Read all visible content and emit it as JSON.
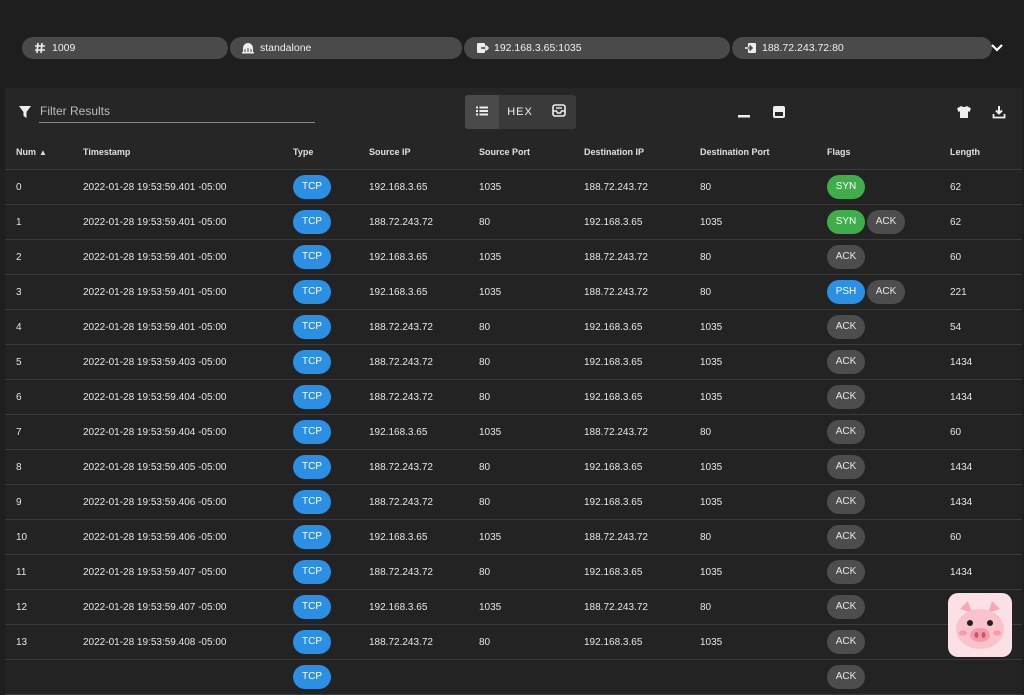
{
  "header": {
    "chips": [
      {
        "icon": "hash-icon",
        "label": "1009"
      },
      {
        "icon": "network-icon",
        "label": "standalone"
      },
      {
        "icon": "login-icon",
        "label": "192.168.3.65:1035"
      },
      {
        "icon": "logout-icon",
        "label": "188.72.243.72:80"
      }
    ]
  },
  "toolbar": {
    "filter_placeholder": "Filter Results",
    "hex_label": "HEX"
  },
  "table": {
    "columns": {
      "num": "Num",
      "timestamp": "Timestamp",
      "type": "Type",
      "src_ip": "Source IP",
      "src_port": "Source Port",
      "dst_ip": "Destination IP",
      "dst_port": "Destination Port",
      "flags": "Flags",
      "length": "Length"
    },
    "rows": [
      {
        "num": "0",
        "ts": "2022-01-28 19:53:59.401 -05:00",
        "type": "TCP",
        "src_ip": "192.168.3.65",
        "src_port": "1035",
        "dst_ip": "188.72.243.72",
        "dst_port": "80",
        "flags": [
          "SYN"
        ],
        "length": "62"
      },
      {
        "num": "1",
        "ts": "2022-01-28 19:53:59.401 -05:00",
        "type": "TCP",
        "src_ip": "188.72.243.72",
        "src_port": "80",
        "dst_ip": "192.168.3.65",
        "dst_port": "1035",
        "flags": [
          "SYN",
          "ACK"
        ],
        "length": "62"
      },
      {
        "num": "2",
        "ts": "2022-01-28 19:53:59.401 -05:00",
        "type": "TCP",
        "src_ip": "192.168.3.65",
        "src_port": "1035",
        "dst_ip": "188.72.243.72",
        "dst_port": "80",
        "flags": [
          "ACK"
        ],
        "length": "60"
      },
      {
        "num": "3",
        "ts": "2022-01-28 19:53:59.401 -05:00",
        "type": "TCP",
        "src_ip": "192.168.3.65",
        "src_port": "1035",
        "dst_ip": "188.72.243.72",
        "dst_port": "80",
        "flags": [
          "PSH",
          "ACK"
        ],
        "length": "221"
      },
      {
        "num": "4",
        "ts": "2022-01-28 19:53:59.401 -05:00",
        "type": "TCP",
        "src_ip": "188.72.243.72",
        "src_port": "80",
        "dst_ip": "192.168.3.65",
        "dst_port": "1035",
        "flags": [
          "ACK"
        ],
        "length": "54"
      },
      {
        "num": "5",
        "ts": "2022-01-28 19:53:59.403 -05:00",
        "type": "TCP",
        "src_ip": "188.72.243.72",
        "src_port": "80",
        "dst_ip": "192.168.3.65",
        "dst_port": "1035",
        "flags": [
          "ACK"
        ],
        "length": "1434"
      },
      {
        "num": "6",
        "ts": "2022-01-28 19:53:59.404 -05:00",
        "type": "TCP",
        "src_ip": "188.72.243.72",
        "src_port": "80",
        "dst_ip": "192.168.3.65",
        "dst_port": "1035",
        "flags": [
          "ACK"
        ],
        "length": "1434"
      },
      {
        "num": "7",
        "ts": "2022-01-28 19:53:59.404 -05:00",
        "type": "TCP",
        "src_ip": "192.168.3.65",
        "src_port": "1035",
        "dst_ip": "188.72.243.72",
        "dst_port": "80",
        "flags": [
          "ACK"
        ],
        "length": "60"
      },
      {
        "num": "8",
        "ts": "2022-01-28 19:53:59.405 -05:00",
        "type": "TCP",
        "src_ip": "188.72.243.72",
        "src_port": "80",
        "dst_ip": "192.168.3.65",
        "dst_port": "1035",
        "flags": [
          "ACK"
        ],
        "length": "1434"
      },
      {
        "num": "9",
        "ts": "2022-01-28 19:53:59.406 -05:00",
        "type": "TCP",
        "src_ip": "188.72.243.72",
        "src_port": "80",
        "dst_ip": "192.168.3.65",
        "dst_port": "1035",
        "flags": [
          "ACK"
        ],
        "length": "1434"
      },
      {
        "num": "10",
        "ts": "2022-01-28 19:53:59.406 -05:00",
        "type": "TCP",
        "src_ip": "192.168.3.65",
        "src_port": "1035",
        "dst_ip": "188.72.243.72",
        "dst_port": "80",
        "flags": [
          "ACK"
        ],
        "length": "60"
      },
      {
        "num": "11",
        "ts": "2022-01-28 19:53:59.407 -05:00",
        "type": "TCP",
        "src_ip": "188.72.243.72",
        "src_port": "80",
        "dst_ip": "192.168.3.65",
        "dst_port": "1035",
        "flags": [
          "ACK"
        ],
        "length": "1434"
      },
      {
        "num": "12",
        "ts": "2022-01-28 19:53:59.407 -05:00",
        "type": "TCP",
        "src_ip": "192.168.3.65",
        "src_port": "1035",
        "dst_ip": "188.72.243.72",
        "dst_port": "80",
        "flags": [
          "ACK"
        ],
        "length": ""
      },
      {
        "num": "13",
        "ts": "2022-01-28 19:53:59.408 -05:00",
        "type": "TCP",
        "src_ip": "188.72.243.72",
        "src_port": "80",
        "dst_ip": "192.168.3.65",
        "dst_port": "1035",
        "flags": [
          "ACK"
        ],
        "length": ""
      },
      {
        "num": "",
        "ts": "",
        "type": "TCP",
        "src_ip": "",
        "src_port": "",
        "dst_ip": "",
        "dst_port": "",
        "flags": [
          "ACK"
        ],
        "length": ""
      }
    ]
  },
  "colors": {
    "tcp": "#2b8fe3",
    "syn": "#3fae4a",
    "psh": "#2b8fe3",
    "ack": "#4d4d4d"
  }
}
